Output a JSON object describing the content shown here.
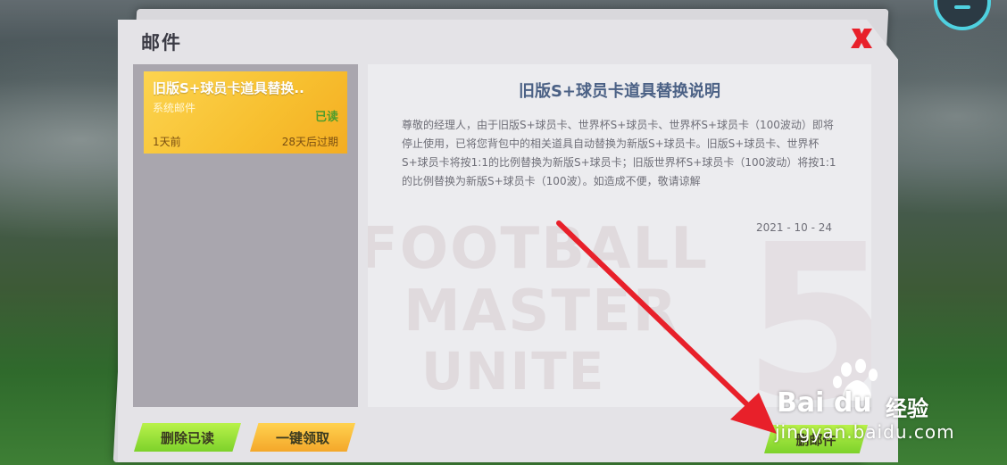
{
  "window": {
    "title": "邮件"
  },
  "mail_list": {
    "items": [
      {
        "title": "旧版S+球员卡道具替换..",
        "sender": "系统邮件",
        "status": "已读",
        "time": "1天前",
        "expire": "28天后过期"
      }
    ]
  },
  "mail_detail": {
    "title": "旧版S+球员卡道具替换说明",
    "body": "尊敬的经理人，由于旧版S+球员卡、世界杯S+球员卡、世界杯S+球员卡（100波动）即将停止使用，已将您背包中的相关道具自动替换为新版S+球员卡。旧版S+球员卡、世界杯S+球员卡将按1:1的比例替换为新版S+球员卡；旧版世界杯S+球员卡（100波动）将按1:1的比例替换为新版S+球员卡（100波）。如造成不便，敬请谅解",
    "date": "2021 - 10 - 24"
  },
  "buttons": {
    "delete_read": "删除已读",
    "claim_all": "一键领取",
    "delete_mail": "删邮件"
  },
  "watermark": {
    "brand_text": "Bai du",
    "brand_cn": "经验",
    "url": "jingyan.baidu.com"
  },
  "colors": {
    "mail_item_bg": "#f7bf2f",
    "read_status": "#4f9d2c",
    "title_blue": "#4b6185",
    "close_red": "#e8202a",
    "button_green": "#7dd22b",
    "button_yellow": "#f4a72a",
    "arrow_red": "#e8202a"
  },
  "icons": {
    "close": "close-x-icon",
    "status_ring": "ring-icon",
    "baidu_paw": "paw-icon"
  }
}
